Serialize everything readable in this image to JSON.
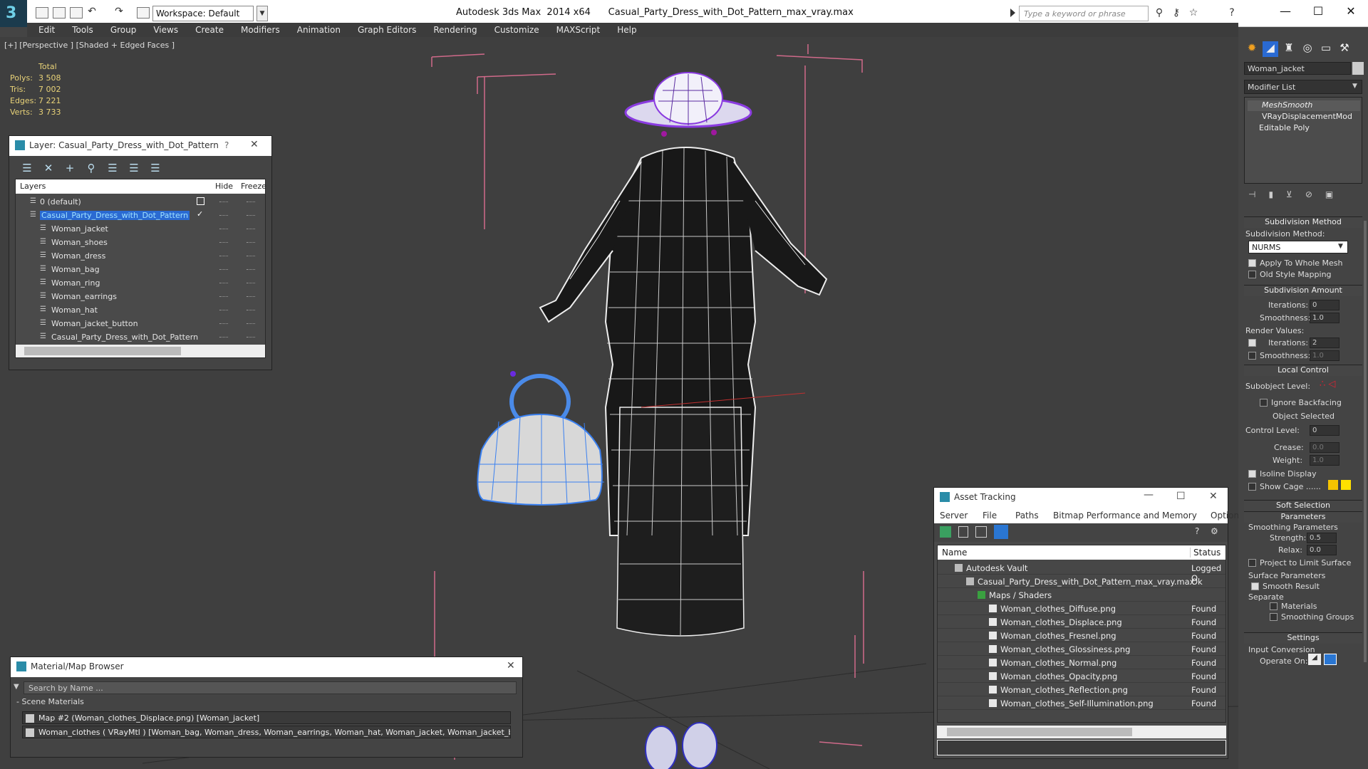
{
  "titlebar": {
    "logo": "3",
    "workspace": "Workspace: Default",
    "app_title": "Autodesk 3ds Max  2014 x64      Casual_Party_Dress_with_Dot_Pattern_max_vray.max",
    "search_placeholder": "Type a keyword or phrase"
  },
  "menubar": [
    "Edit",
    "Tools",
    "Group",
    "Views",
    "Create",
    "Modifiers",
    "Animation",
    "Graph Editors",
    "Rendering",
    "Customize",
    "MAXScript",
    "Help"
  ],
  "viewport": {
    "label": "[+] [Perspective ] [Shaded + Edged Faces ]",
    "stats_header": "Total",
    "stats": [
      {
        "k": "Polys:",
        "v": "3 508"
      },
      {
        "k": "Tris:",
        "v": "7 002"
      },
      {
        "k": "Edges:",
        "v": "7 221"
      },
      {
        "k": "Verts:",
        "v": "3 733"
      }
    ]
  },
  "layer_panel": {
    "title": "Layer: Casual_Party_Dress_with_Dot_Pattern",
    "help": "?",
    "close": "✕",
    "col_layers": "Layers",
    "col_hide": "Hide",
    "col_freeze": "Freeze",
    "rows": [
      {
        "name": "0 (default)",
        "level": 0
      },
      {
        "name": "Casual_Party_Dress_with_Dot_Pattern",
        "level": 0,
        "selected": true
      },
      {
        "name": "Woman_jacket",
        "level": 1
      },
      {
        "name": "Woman_shoes",
        "level": 1
      },
      {
        "name": "Woman_dress",
        "level": 1
      },
      {
        "name": "Woman_bag",
        "level": 1
      },
      {
        "name": "Woman_ring",
        "level": 1
      },
      {
        "name": "Woman_earrings",
        "level": 1
      },
      {
        "name": "Woman_hat",
        "level": 1
      },
      {
        "name": "Woman_jacket_button",
        "level": 1
      },
      {
        "name": "Casual_Party_Dress_with_Dot_Pattern",
        "level": 1
      }
    ]
  },
  "material_browser": {
    "title": "Material/Map Browser",
    "close": "✕",
    "search_placeholder": "Search by Name ...",
    "group": "- Scene Materials",
    "items": [
      "Map #2 (Woman_clothes_Displace.png) [Woman_jacket]",
      "Woman_clothes  ( VRayMtl ) [Woman_bag, Woman_dress, Woman_earrings, Woman_hat, Woman_jacket, Woman_jacket_butto..."
    ]
  },
  "asset_tracking": {
    "title": "Asset Tracking",
    "menu": [
      "Server",
      "File",
      "Paths",
      "Bitmap Performance and Memory",
      "Options"
    ],
    "col_name": "Name",
    "col_status": "Status",
    "rows": [
      {
        "name": "Autodesk Vault",
        "status": "Logged O",
        "indent": 1,
        "icon": "vault-icon"
      },
      {
        "name": "Casual_Party_Dress_with_Dot_Pattern_max_vray.max",
        "status": "Ok",
        "indent": 2,
        "icon": "max-file-icon"
      },
      {
        "name": "Maps / Shaders",
        "status": "",
        "indent": 3,
        "icon": "maps-icon"
      },
      {
        "name": "Woman_clothes_Diffuse.png",
        "status": "Found",
        "indent": 4,
        "icon": "png-icon"
      },
      {
        "name": "Woman_clothes_Displace.png",
        "status": "Found",
        "indent": 4,
        "icon": "png-icon"
      },
      {
        "name": "Woman_clothes_Fresnel.png",
        "status": "Found",
        "indent": 4,
        "icon": "png-icon"
      },
      {
        "name": "Woman_clothes_Glossiness.png",
        "status": "Found",
        "indent": 4,
        "icon": "png-icon"
      },
      {
        "name": "Woman_clothes_Normal.png",
        "status": "Found",
        "indent": 4,
        "icon": "png-icon"
      },
      {
        "name": "Woman_clothes_Opacity.png",
        "status": "Found",
        "indent": 4,
        "icon": "png-icon"
      },
      {
        "name": "Woman_clothes_Reflection.png",
        "status": "Found",
        "indent": 4,
        "icon": "png-icon"
      },
      {
        "name": "Woman_clothes_Self-Illumination.png",
        "status": "Found",
        "indent": 4,
        "icon": "png-icon"
      }
    ]
  },
  "command_panel": {
    "object_name": "Woman_jacket",
    "modifier_list": "Modifier List",
    "stack": [
      "MeshSmooth",
      "VRayDisplacementMod",
      "Editable Poly"
    ],
    "subdivision_method_roll": "Subdivision Method",
    "subdivision_method_label": "Subdivision Method:",
    "subdivision_method_value": "NURMS",
    "apply_whole_mesh": "Apply To Whole Mesh",
    "old_style_mapping": "Old Style Mapping",
    "subdivision_amount_roll": "Subdivision Amount",
    "iterations_label": "Iterations:",
    "iterations_value": "0",
    "smoothness_label": "Smoothness:",
    "smoothness_value": "1.0",
    "render_values": "Render Values:",
    "render_iterations_value": "2",
    "render_smoothness_value": "1.0",
    "local_control_roll": "Local Control",
    "subobject_level": "Subobject Level:",
    "ignore_backfacing": "Ignore Backfacing",
    "object_selected": "Object Selected",
    "control_level": "Control Level:",
    "control_level_value": "0",
    "crease": "Crease:",
    "crease_value": "0.0",
    "weight": "Weight:",
    "weight_value": "1.0",
    "isoline_display": "Isoline Display",
    "show_cage": "Show Cage ......",
    "soft_selection_roll": "Soft Selection",
    "parameters_roll": "Parameters",
    "smoothing_parameters": "Smoothing Parameters",
    "strength": "Strength:",
    "strength_value": "0.5",
    "relax": "Relax:",
    "relax_value": "0.0",
    "project_limit": "Project to Limit Surface",
    "surface_parameters": "Surface Parameters",
    "smooth_result": "Smooth Result",
    "separate": "Separate",
    "materials": "Materials",
    "smoothing_groups": "Smoothing Groups",
    "settings_roll": "Settings",
    "input_conversion": "Input Conversion",
    "operate_on": "Operate On:",
    "colors": {
      "cage1": "#f5c400",
      "cage2": "#ffe000"
    }
  }
}
